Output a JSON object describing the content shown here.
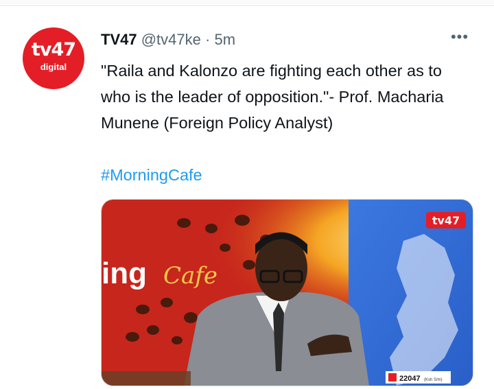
{
  "tweet": {
    "display_name": "TV47",
    "handle": "@tv47ke",
    "separator": "·",
    "time": "5m",
    "more_glyph": "•••",
    "text": "\"Raila and Kalonzo are fighting each other as to who is the leader of opposition.\"- Prof. Macharia Munene (Foreign Policy Analyst)",
    "hashtag": "#MorningCafe"
  },
  "avatar": {
    "logo_main": "tv47",
    "logo_sub": "digital",
    "color": "#e41e26"
  },
  "media": {
    "studio_text": "ing",
    "cafe_text": "Cafe",
    "channel_logo": "tv47",
    "ticker_value": "22047",
    "ticker_unit": "(Ksh S/m)"
  },
  "colors": {
    "accent": "#1d9bf0",
    "text": "#0f1419",
    "muted": "#536471"
  }
}
